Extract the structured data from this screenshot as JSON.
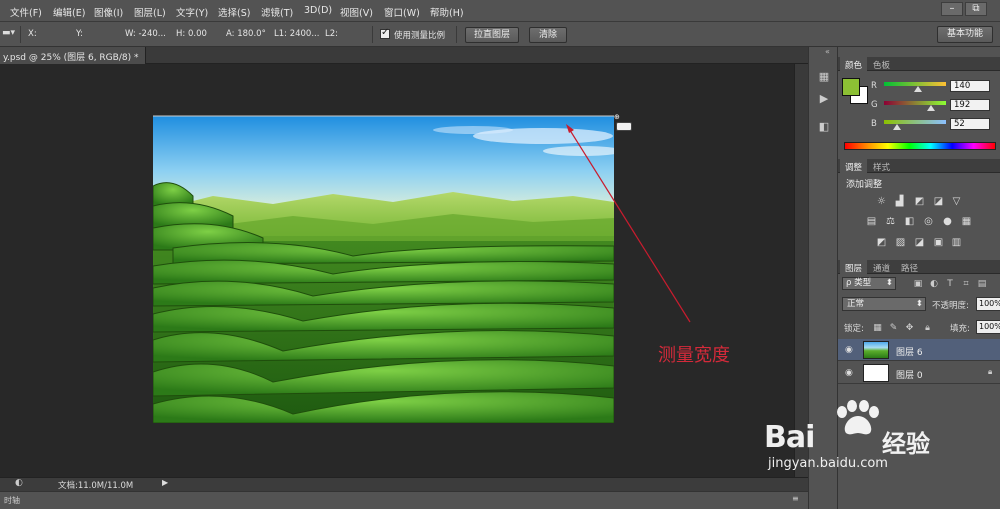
{
  "menubar": {
    "items": [
      "文件(F)",
      "编辑(E)",
      "图像(I)",
      "图层(L)",
      "文字(Y)",
      "选择(S)",
      "滤镜(T)",
      "3D(D)",
      "视图(V)",
      "窗口(W)",
      "帮助(H)"
    ],
    "restore_btn": "⧉"
  },
  "options": {
    "x_label": "X:",
    "y_label": "Y:",
    "w_text": "W: -240...",
    "h_text": "H: 0.00",
    "a_text": "A: 180.0°",
    "l1_text": "L1: 2400...",
    "l2_text": "L2:",
    "use_scale_label": "使用测量比例",
    "straighten_btn": "拉直图层",
    "clear_btn": "清除",
    "workspace": "基本功能"
  },
  "document": {
    "tab_title": "y.psd @ 25% (图层 6, RGB/8) *",
    "annotation": "测量宽度",
    "annotation_color": "#c81c2e"
  },
  "status": {
    "doc_size": "文档:11.0M/11.0M",
    "bottom_label": "时轴"
  },
  "color_panel": {
    "tabs": [
      "颜色",
      "色板"
    ],
    "foreground": "#8cc034",
    "r_label": "R",
    "r_value": "140",
    "g_label": "G",
    "g_value": "192",
    "b_label": "B",
    "b_value": "52"
  },
  "adjust_panel": {
    "tabs": [
      "调整",
      "样式"
    ],
    "title": "添加调整"
  },
  "layers_panel": {
    "tabs": [
      "图层",
      "通道",
      "路径"
    ],
    "filter_label": "ρ 类型",
    "blend_mode": "正常",
    "opacity_label": "不透明度:",
    "opacity_value": "100%",
    "lock_label": "锁定:",
    "fill_label": "填充:",
    "fill_value": "100%",
    "layers": [
      {
        "name": "图层 6"
      },
      {
        "name": "图层 0"
      }
    ]
  },
  "watermark": {
    "brand": "Bai",
    "brand2": "经验",
    "url": "jingyan.baidu.com"
  }
}
